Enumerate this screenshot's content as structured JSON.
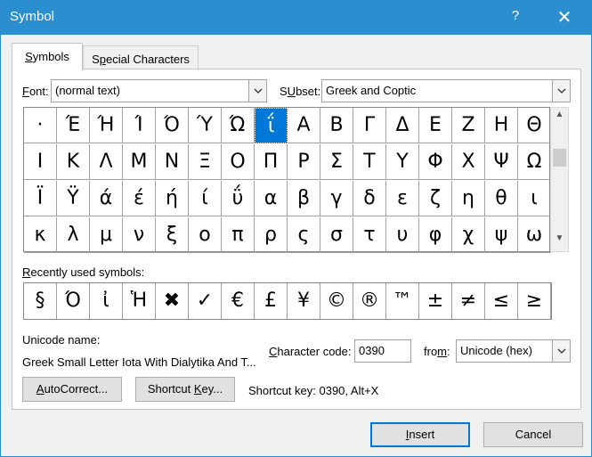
{
  "window": {
    "title": "Symbol",
    "help": "?",
    "close": "✕"
  },
  "tabs": [
    {
      "label": "Symbols",
      "mnemonic": "S",
      "rest": "ymbols",
      "active": true
    },
    {
      "label": "Special Characters",
      "pre": "S",
      "mnemonic": "p",
      "rest": "ecial Characters",
      "active": false
    }
  ],
  "font": {
    "label_mn": "F",
    "label_rest": "ont:",
    "value": "(normal text)"
  },
  "subset": {
    "label_mn": "U",
    "label_rest": "bset:",
    "label_pre": "S",
    "value": "Greek and Coptic"
  },
  "symbols": [
    [
      "·",
      "Έ",
      "Ή",
      "Ί",
      "Ό",
      "Ύ",
      "Ώ",
      "ΐ",
      "Α",
      "Β",
      "Γ",
      "Δ",
      "Ε",
      "Ζ",
      "Η",
      "Θ"
    ],
    [
      "Ι",
      "Κ",
      "Λ",
      "Μ",
      "Ν",
      "Ξ",
      "Ο",
      "Π",
      "Ρ",
      "Σ",
      "Τ",
      "Υ",
      "Φ",
      "Χ",
      "Ψ",
      "Ω"
    ],
    [
      "Ϊ",
      "Ϋ",
      "ά",
      "έ",
      "ή",
      "ί",
      "ΰ",
      "α",
      "β",
      "γ",
      "δ",
      "ε",
      "ζ",
      "η",
      "θ",
      "ι"
    ],
    [
      "κ",
      "λ",
      "μ",
      "ν",
      "ξ",
      "ο",
      "π",
      "ρ",
      "ς",
      "σ",
      "τ",
      "υ",
      "φ",
      "χ",
      "ψ",
      "ω"
    ]
  ],
  "selected": {
    "row": 0,
    "col": 7
  },
  "recent": {
    "label_mn": "R",
    "label_rest": "ecently used symbols:",
    "items": [
      "§",
      "Ό",
      "ἰ",
      "Ἡ",
      "✖",
      "✓",
      "€",
      "£",
      "¥",
      "©",
      "®",
      "™",
      "±",
      "≠",
      "≤",
      "≥"
    ]
  },
  "unicode_name": {
    "label": "Unicode name:",
    "value": "Greek Small Letter Iota With Dialytika And T..."
  },
  "char_code": {
    "label_mn": "C",
    "label_rest": "haracter code:",
    "value": "0390"
  },
  "from": {
    "label_pre": "fro",
    "label_mn": "m",
    "label_rest": ":",
    "value": "Unicode (hex)"
  },
  "buttons": {
    "autocorrect": {
      "mn": "A",
      "rest": "utoCorrect..."
    },
    "shortcut_key": {
      "pre": "Shortcut ",
      "mn": "K",
      "rest": "ey..."
    },
    "insert": {
      "mn": "I",
      "rest": "nsert"
    },
    "cancel": "Cancel"
  },
  "shortcut_text": "Shortcut key: 0390, Alt+X",
  "colors": {
    "titlebar": "#2b8fcf",
    "selection": "#0078d7"
  }
}
